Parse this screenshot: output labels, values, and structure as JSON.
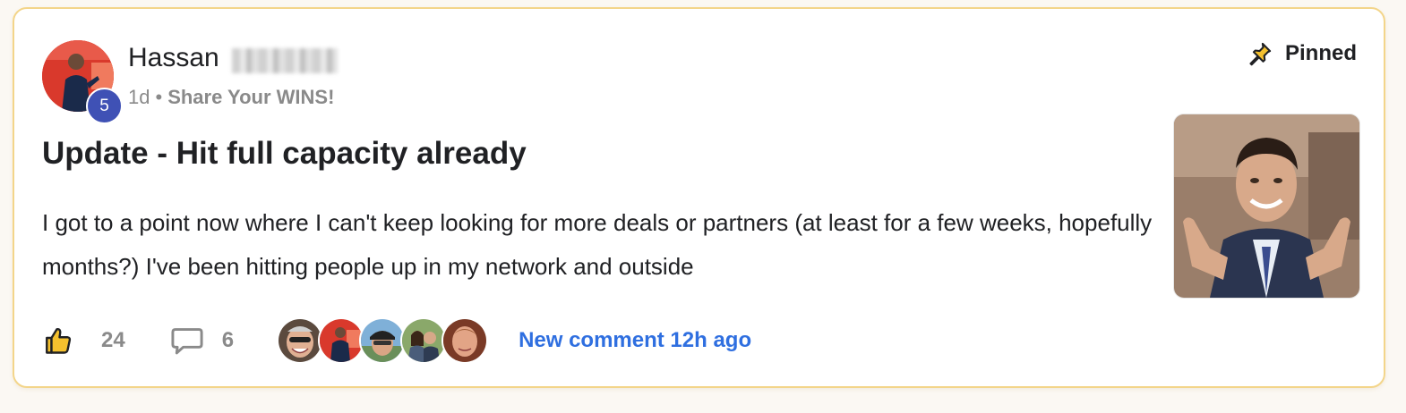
{
  "post": {
    "author": {
      "name": "Hassan",
      "level": "5"
    },
    "time_ago": "1d",
    "separator": "•",
    "category": "Share Your WINS!",
    "pinned_label": "Pinned",
    "title": "Update - Hit full capacity already",
    "body": "I got to a point now where I can't keep looking for more deals or partners (at least for a few weeks, hopefully months?) I've been hitting people up in my network and outside",
    "likes": "24",
    "comments": "6",
    "last_comment": "New comment 12h ago"
  },
  "icons": {
    "like": "thumbs-up-icon",
    "comment": "comment-bubble-icon",
    "pin": "pushpin-icon"
  },
  "colors": {
    "card_border": "#f3d58a",
    "level_badge": "#3f51b5",
    "link": "#2f6fe0",
    "muted_text": "#8a8a8a"
  }
}
